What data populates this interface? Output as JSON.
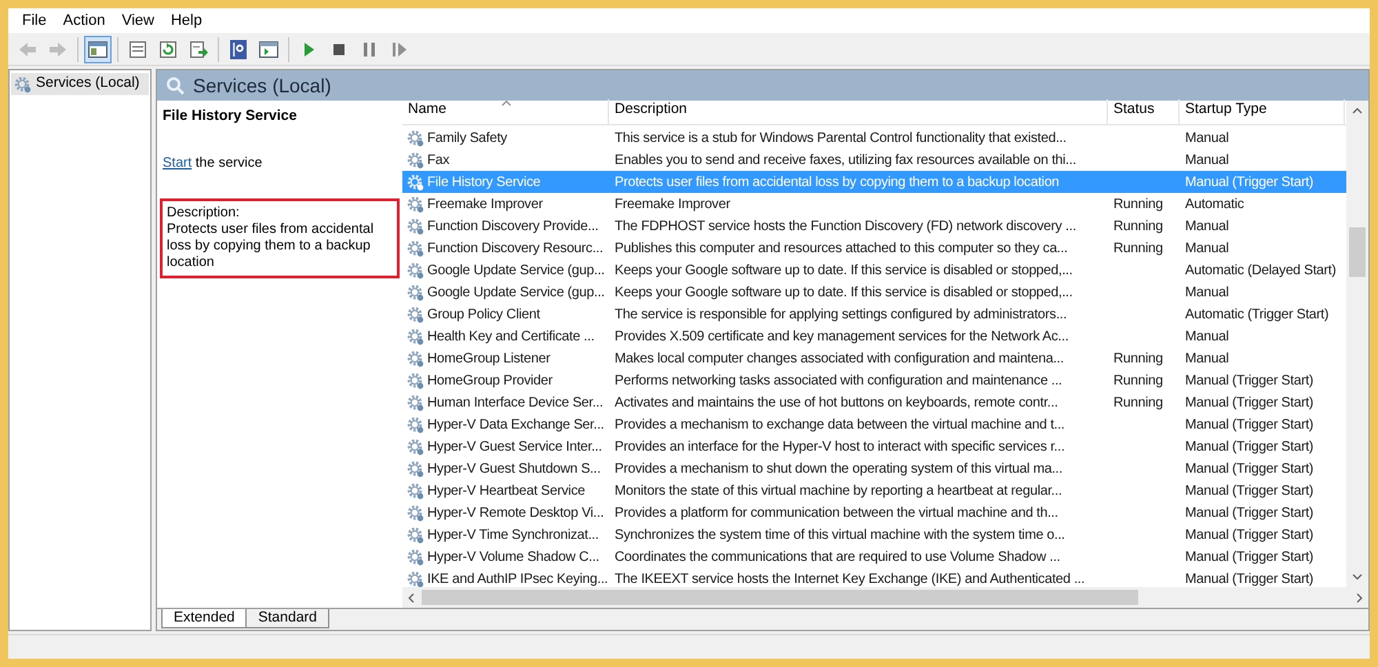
{
  "menu": [
    "File",
    "Action",
    "View",
    "Help"
  ],
  "toolbar": [
    {
      "kind": "back",
      "disabled": true,
      "pressed": false
    },
    {
      "kind": "forward",
      "disabled": true,
      "pressed": false
    },
    {
      "kind": "sep"
    },
    {
      "kind": "console-tree",
      "disabled": false,
      "pressed": true
    },
    {
      "kind": "sep"
    },
    {
      "kind": "properties",
      "disabled": false,
      "pressed": false
    },
    {
      "kind": "refresh",
      "disabled": false,
      "pressed": false
    },
    {
      "kind": "export",
      "disabled": false,
      "pressed": false
    },
    {
      "kind": "sep"
    },
    {
      "kind": "help",
      "disabled": false,
      "pressed": false
    },
    {
      "kind": "action-pane",
      "disabled": false,
      "pressed": false
    },
    {
      "kind": "sep"
    },
    {
      "kind": "play",
      "disabled": false,
      "pressed": false
    },
    {
      "kind": "stop",
      "disabled": false,
      "pressed": false
    },
    {
      "kind": "pause",
      "disabled": false,
      "pressed": false
    },
    {
      "kind": "restart",
      "disabled": false,
      "pressed": false
    }
  ],
  "tree": {
    "items": [
      {
        "label": "Services (Local)",
        "selected": true
      }
    ]
  },
  "panel_title": "Services (Local)",
  "detail": {
    "title": "File History Service",
    "action_link": "Start",
    "action_text": "the service",
    "description_label": "Description:",
    "description": "Protects user files from accidental loss by copying them to a backup location"
  },
  "table": {
    "columns": [
      "Name",
      "Description",
      "Status",
      "Startup Type"
    ],
    "rows": [
      {
        "name": "Family Safety",
        "description": "This service is a stub for Windows Parental Control functionality that existed...",
        "status": "",
        "startup": "Manual",
        "selected": false
      },
      {
        "name": "Fax",
        "description": "Enables you to send and receive faxes, utilizing fax resources available on thi...",
        "status": "",
        "startup": "Manual",
        "selected": false
      },
      {
        "name": "File History Service",
        "description": "Protects user files from accidental loss by copying them to a backup location",
        "status": "",
        "startup": "Manual (Trigger Start)",
        "selected": true
      },
      {
        "name": "Freemake Improver",
        "description": "Freemake Improver",
        "status": "Running",
        "startup": "Automatic",
        "selected": false
      },
      {
        "name": "Function Discovery Provide...",
        "description": "The FDPHOST service hosts the Function Discovery (FD) network discovery ...",
        "status": "Running",
        "startup": "Manual",
        "selected": false
      },
      {
        "name": "Function Discovery Resourc...",
        "description": "Publishes this computer and resources attached to this computer so they ca...",
        "status": "Running",
        "startup": "Manual",
        "selected": false
      },
      {
        "name": "Google Update Service (gup...",
        "description": "Keeps your Google software up to date. If this service is disabled or stopped,...",
        "status": "",
        "startup": "Automatic (Delayed Start)",
        "selected": false
      },
      {
        "name": "Google Update Service (gup...",
        "description": "Keeps your Google software up to date. If this service is disabled or stopped,...",
        "status": "",
        "startup": "Manual",
        "selected": false
      },
      {
        "name": "Group Policy Client",
        "description": "The service is responsible for applying settings configured by administrators...",
        "status": "",
        "startup": "Automatic (Trigger Start)",
        "selected": false
      },
      {
        "name": "Health Key and Certificate ...",
        "description": "Provides X.509 certificate and key management services for the Network Ac...",
        "status": "",
        "startup": "Manual",
        "selected": false
      },
      {
        "name": "HomeGroup Listener",
        "description": "Makes local computer changes associated with configuration and maintena...",
        "status": "Running",
        "startup": "Manual",
        "selected": false
      },
      {
        "name": "HomeGroup Provider",
        "description": "Performs networking tasks associated with configuration and maintenance ...",
        "status": "Running",
        "startup": "Manual (Trigger Start)",
        "selected": false
      },
      {
        "name": "Human Interface Device Ser...",
        "description": "Activates and maintains the use of hot buttons on keyboards, remote contr...",
        "status": "Running",
        "startup": "Manual (Trigger Start)",
        "selected": false
      },
      {
        "name": "Hyper-V Data Exchange Ser...",
        "description": "Provides a mechanism to exchange data between the virtual machine and t...",
        "status": "",
        "startup": "Manual (Trigger Start)",
        "selected": false
      },
      {
        "name": "Hyper-V Guest Service Inter...",
        "description": "Provides an interface for the Hyper-V host to interact with specific services r...",
        "status": "",
        "startup": "Manual (Trigger Start)",
        "selected": false
      },
      {
        "name": "Hyper-V Guest Shutdown S...",
        "description": "Provides a mechanism to shut down the operating system of this virtual ma...",
        "status": "",
        "startup": "Manual (Trigger Start)",
        "selected": false
      },
      {
        "name": "Hyper-V Heartbeat Service",
        "description": "Monitors the state of this virtual machine by reporting a heartbeat at regular...",
        "status": "",
        "startup": "Manual (Trigger Start)",
        "selected": false
      },
      {
        "name": "Hyper-V Remote Desktop Vi...",
        "description": "Provides a platform for communication between the virtual machine and th...",
        "status": "",
        "startup": "Manual (Trigger Start)",
        "selected": false
      },
      {
        "name": "Hyper-V Time Synchronizat...",
        "description": "Synchronizes the system time of this virtual machine with the system time o...",
        "status": "",
        "startup": "Manual (Trigger Start)",
        "selected": false
      },
      {
        "name": "Hyper-V Volume Shadow C...",
        "description": "Coordinates the communications that are required to use Volume Shadow ...",
        "status": "",
        "startup": "Manual (Trigger Start)",
        "selected": false
      },
      {
        "name": "IKE and AuthIP IPsec Keying...",
        "description": "The IKEEXT service hosts the Internet Key Exchange (IKE) and Authenticated ...",
        "status": "",
        "startup": "Manual (Trigger Start)",
        "selected": false
      }
    ]
  },
  "view_tabs": [
    {
      "label": "Extended",
      "selected": true
    },
    {
      "label": "Standard",
      "selected": false
    }
  ]
}
